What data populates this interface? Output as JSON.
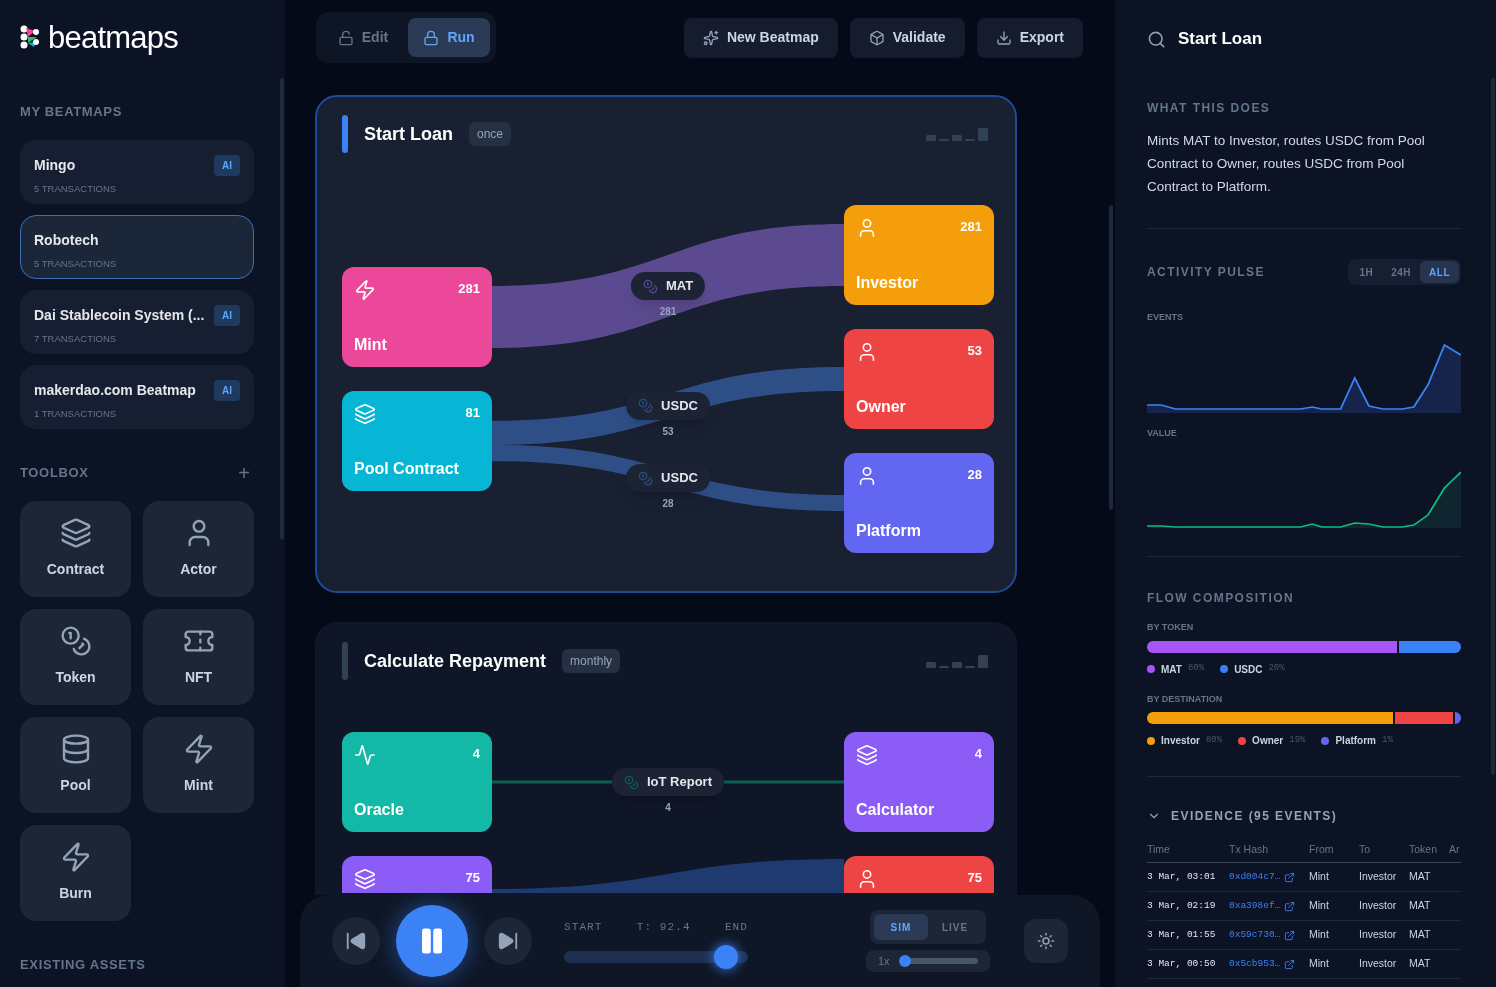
{
  "logo": {
    "text": "beatmaps"
  },
  "my_beatmaps": {
    "title": "MY BEATMAPS",
    "items": [
      {
        "name": "Mingo",
        "count": "5 TRANSACTIONS",
        "badge": "AI",
        "selected": false
      },
      {
        "name": "Robotech",
        "count": "5 TRANSACTIONS",
        "selected": true
      },
      {
        "name": "Dai Stablecoin System (...",
        "count": "7 TRANSACTIONS",
        "badge": "AI",
        "selected": false
      },
      {
        "name": "makerdao.com Beatmap",
        "count": "1 TRANSACTIONS",
        "badge": "AI",
        "selected": false
      }
    ]
  },
  "toolbox": {
    "title": "TOOLBOX",
    "add": "+",
    "tools": [
      {
        "kind": "contract",
        "label": "Contract"
      },
      {
        "kind": "actor",
        "label": "Actor"
      },
      {
        "kind": "token",
        "label": "Token"
      },
      {
        "kind": "nft",
        "label": "NFT"
      },
      {
        "kind": "pool",
        "label": "Pool"
      },
      {
        "kind": "mint",
        "label": "Mint"
      },
      {
        "kind": "mint",
        "label": "Burn"
      }
    ]
  },
  "existing_assets": {
    "title": "EXISTING ASSETS"
  },
  "mode_tabs": [
    {
      "label": "Edit",
      "kind": "unlocked",
      "selected": false
    },
    {
      "label": "Run",
      "kind": "locked",
      "selected": true
    }
  ],
  "actions": [
    {
      "kind": "sparkles",
      "label": "New Beatmap"
    },
    {
      "kind": "box",
      "label": "Validate"
    },
    {
      "kind": "download",
      "label": "Export"
    }
  ],
  "steps": [
    {
      "title": "Start Loan",
      "badge": "once",
      "selected": true,
      "sources": [
        {
          "kind": "mint",
          "label": "Mint",
          "count": "281",
          "color": "#ec4899",
          "flows": [
            {
              "token": "MAT",
              "count": "281",
              "color": "#5b4a8f"
            }
          ]
        },
        {
          "kind": "contract",
          "label": "Pool Contract",
          "count": "81",
          "color": "#06b6d4",
          "flows": [
            {
              "token": "USDC",
              "count": "53",
              "color": "#2e4f85"
            },
            {
              "token": "USDC",
              "count": "28",
              "color": "#2e4f85"
            }
          ]
        }
      ],
      "targets": [
        {
          "kind": "actor",
          "label": "Investor",
          "count": "281",
          "color": "#f59e0b"
        },
        {
          "kind": "actor",
          "label": "Owner",
          "count": "53",
          "color": "#ef4444"
        },
        {
          "kind": "actor",
          "label": "Platform",
          "count": "28",
          "color": "#6366f1"
        }
      ]
    },
    {
      "title": "Calculate Repayment",
      "badge": "monthly",
      "selected": false,
      "sources": [
        {
          "kind": "oracle",
          "label": "Oracle",
          "count": "4",
          "color": "#14b8a6",
          "flows": [
            {
              "token": "IoT Report",
              "count": "4",
              "color": "#115e4e"
            }
          ]
        },
        {
          "kind": "contract",
          "count": "75",
          "color": "#8b5cf6",
          "flows": [
            {
              "color": "#1e3a6e"
            }
          ]
        }
      ],
      "targets": [
        {
          "kind": "contract",
          "label": "Calculator",
          "count": "4",
          "color": "#8b5cf6"
        },
        {
          "kind": "actor",
          "count": "75",
          "color": "#ef4444"
        }
      ]
    }
  ],
  "playback": {
    "playing": true,
    "start_label": "START",
    "time": "T: 92.4",
    "end_label": "END",
    "level": 0.88,
    "modes": [
      {
        "label": "SIM",
        "selected": true
      },
      {
        "label": "LIVE",
        "selected": false
      }
    ],
    "speed": {
      "label": "1x",
      "level": 0.05
    }
  },
  "details": {
    "title": "Start Loan",
    "what_title": "WHAT THIS DOES",
    "description": "Mints MAT to Investor, routes USDC from Pool Contract to Owner, routes USDC from Pool Contract to Platform.",
    "pulse": {
      "title": "ACTIVITY PULSE",
      "ranges": [
        {
          "label": "1H",
          "selected": false
        },
        {
          "label": "24H",
          "selected": false
        },
        {
          "label": "ALL",
          "selected": true
        }
      ],
      "events_label": "EVENTS",
      "value_label": "VALUE"
    },
    "composition": {
      "title": "FLOW COMPOSITION",
      "groups": [
        {
          "title": "BY TOKEN",
          "segments": [
            {
              "name": "MAT",
              "pct": "80%",
              "color": "#a855f7"
            },
            {
              "name": "USDC",
              "pct": "20%",
              "color": "#3b82f6"
            }
          ]
        },
        {
          "title": "BY DESTINATION",
          "segments": [
            {
              "name": "Investor",
              "pct": "80%",
              "color": "#f59e0b"
            },
            {
              "name": "Owner",
              "pct": "19%",
              "color": "#ef4444"
            },
            {
              "name": "Platform",
              "pct": "1%",
              "color": "#6366f1"
            }
          ]
        }
      ]
    },
    "evidence": {
      "title": "EVIDENCE (95 EVENTS)",
      "expanded": true,
      "columns": [
        "Time",
        "Tx Hash",
        "From",
        "To",
        "Token",
        "Ar"
      ],
      "rows": [
        {
          "time": "3 Mar, 03:01",
          "hash": "0xd004c7…",
          "from": "Mint",
          "to": "Investor",
          "token": "MAT"
        },
        {
          "time": "3 Mar, 02:19",
          "hash": "0xa398ef…",
          "from": "Mint",
          "to": "Investor",
          "token": "MAT"
        },
        {
          "time": "3 Mar, 01:55",
          "hash": "0x59c730…",
          "from": "Mint",
          "to": "Investor",
          "token": "MAT"
        },
        {
          "time": "3 Mar, 00:50",
          "hash": "0x5cb953…",
          "from": "Mint",
          "to": "Investor",
          "token": "MAT"
        }
      ]
    }
  }
}
